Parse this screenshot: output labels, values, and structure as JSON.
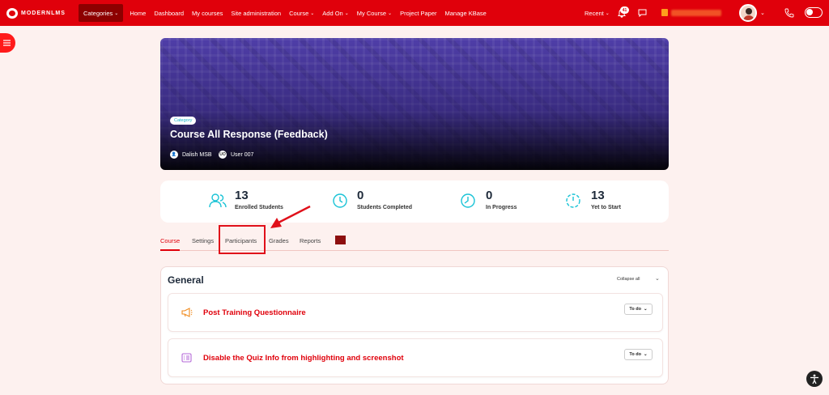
{
  "brand": {
    "name": "MODERNLMS"
  },
  "nav": {
    "items": [
      {
        "label": "Categories",
        "caret": "⌄"
      },
      {
        "label": "Home",
        "caret": ""
      },
      {
        "label": "Dashboard",
        "caret": ""
      },
      {
        "label": "My courses",
        "caret": ""
      },
      {
        "label": "Site administration",
        "caret": ""
      },
      {
        "label": "Course",
        "caret": "⌄"
      },
      {
        "label": "Add On",
        "caret": "⌄"
      },
      {
        "label": "My Course",
        "caret": "⌄"
      },
      {
        "label": "Project Paper",
        "caret": ""
      },
      {
        "label": "Manage KBase",
        "caret": ""
      }
    ],
    "recent_label": "Recent",
    "notification_count": "41"
  },
  "hero": {
    "category": "Category",
    "title": "Course All Response (Feedback)",
    "teachers": [
      {
        "initials": "",
        "name": "Dalish MSB"
      },
      {
        "initials": "UO",
        "name": "User 007"
      }
    ]
  },
  "stats": [
    {
      "value": "13",
      "label": "Enrolled Students",
      "icon": "users-icon"
    },
    {
      "value": "0",
      "label": "Students Completed",
      "icon": "clock-icon"
    },
    {
      "value": "0",
      "label": "In Progress",
      "icon": "progress-clock-icon"
    },
    {
      "value": "13",
      "label": "Yet to Start",
      "icon": "timer-icon"
    }
  ],
  "tabs": [
    {
      "label": "Course",
      "active": true
    },
    {
      "label": "Settings",
      "active": false
    },
    {
      "label": "Participants",
      "active": false
    },
    {
      "label": "Grades",
      "active": false
    },
    {
      "label": "Reports",
      "active": false
    }
  ],
  "general": {
    "title": "General",
    "collapse_label": "Collapse all",
    "activities": [
      {
        "name": "Post Training Questionnaire",
        "status": "To do",
        "icon": "megaphone-icon"
      },
      {
        "name": "Disable the Quiz Info from highlighting and screenshot",
        "status": "To do",
        "icon": "quiz-icon"
      }
    ]
  },
  "colors": {
    "brand_red": "#e0000b",
    "accent_cyan": "#19c3d6",
    "quiz_purple": "#b56ad8",
    "feedback_orange": "#f08a1c"
  }
}
